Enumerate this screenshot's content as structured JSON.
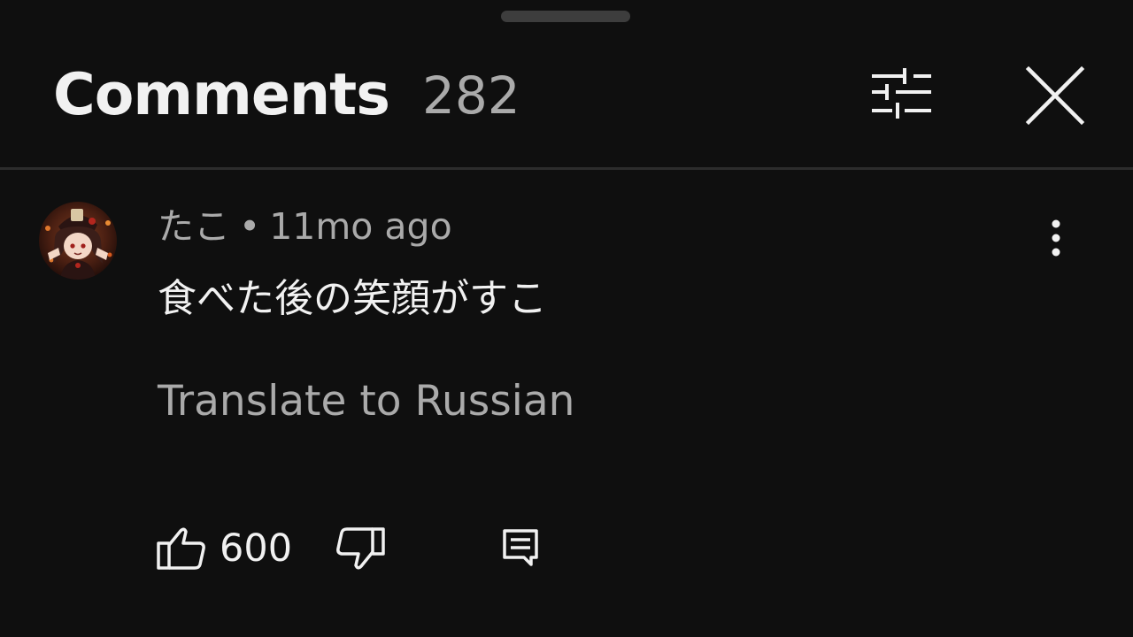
{
  "header": {
    "title": "Comments",
    "count": "282",
    "filter_icon": "sort-sliders-icon",
    "close_icon": "close-icon"
  },
  "comment": {
    "author": "たこ",
    "separator": "•",
    "time": "11mo ago",
    "text": "食べた後の笑顔がすこ",
    "translate_label": "Translate to Russian",
    "like_count": "600",
    "like_icon": "thumbs-up-icon",
    "dislike_icon": "thumbs-down-icon",
    "reply_icon": "reply-comment-icon",
    "more_icon": "more-vertical-icon"
  },
  "colors": {
    "background": "#0f0f0f",
    "primary_text": "#f1f1f1",
    "secondary_text": "#aaaaaa",
    "divider": "#2c2c2c"
  }
}
